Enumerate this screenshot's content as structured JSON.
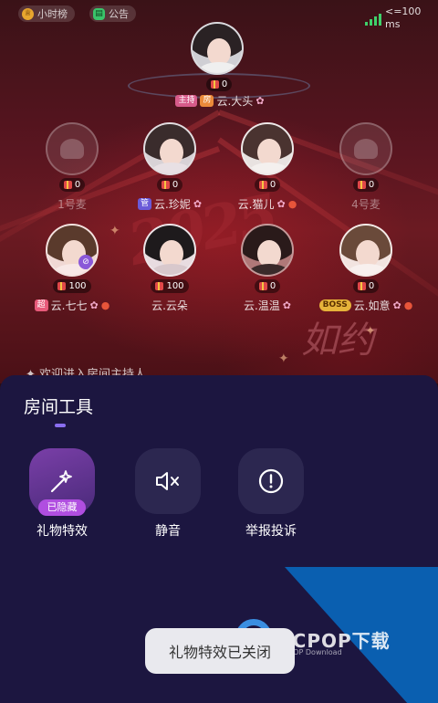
{
  "top_bar": {
    "rank_chip": "小时榜",
    "notice_chip": "公告",
    "network": "<=100ms"
  },
  "host": {
    "count": "0",
    "tag_host": "主持",
    "tag_room": "房",
    "name": "云.大头"
  },
  "seats": [
    {
      "count": "0",
      "name": "1号麦",
      "tag": "",
      "empty": true
    },
    {
      "count": "0",
      "name": "云.珍妮",
      "tag": "管",
      "empty": false
    },
    {
      "count": "0",
      "name": "云.猫儿",
      "tag": "",
      "empty": false
    },
    {
      "count": "0",
      "name": "4号麦",
      "tag": "",
      "empty": true
    },
    {
      "count": "100",
      "name": "云.七七",
      "tag": "超",
      "empty": false
    },
    {
      "count": "100",
      "name": "云.云朵",
      "tag": "",
      "empty": false
    },
    {
      "count": "0",
      "name": "云.温温",
      "tag": "",
      "empty": false
    },
    {
      "count": "0",
      "name": "云.如意",
      "tag": "BOSS",
      "empty": false
    }
  ],
  "background": {
    "deco_text": "如约"
  },
  "welcome_text": "欢迎进入房间主持人",
  "sheet": {
    "title": "房间工具",
    "tools": [
      {
        "label": "礼物特效",
        "badge": "已隐藏",
        "icon": "magic-wand-icon"
      },
      {
        "label": "静音",
        "icon": "speaker-mute-icon"
      },
      {
        "label": "举报投诉",
        "icon": "warning-circle-icon"
      }
    ]
  },
  "toast": "礼物特效已关闭",
  "watermark": {
    "text": "PCPOP下载",
    "sub": "PCPOP Download"
  },
  "colors": {
    "sheet_bg": "#1c1640",
    "tool_bg": "#2c2750",
    "accent": "#8a6ef0",
    "badge": "#b04ee0"
  }
}
